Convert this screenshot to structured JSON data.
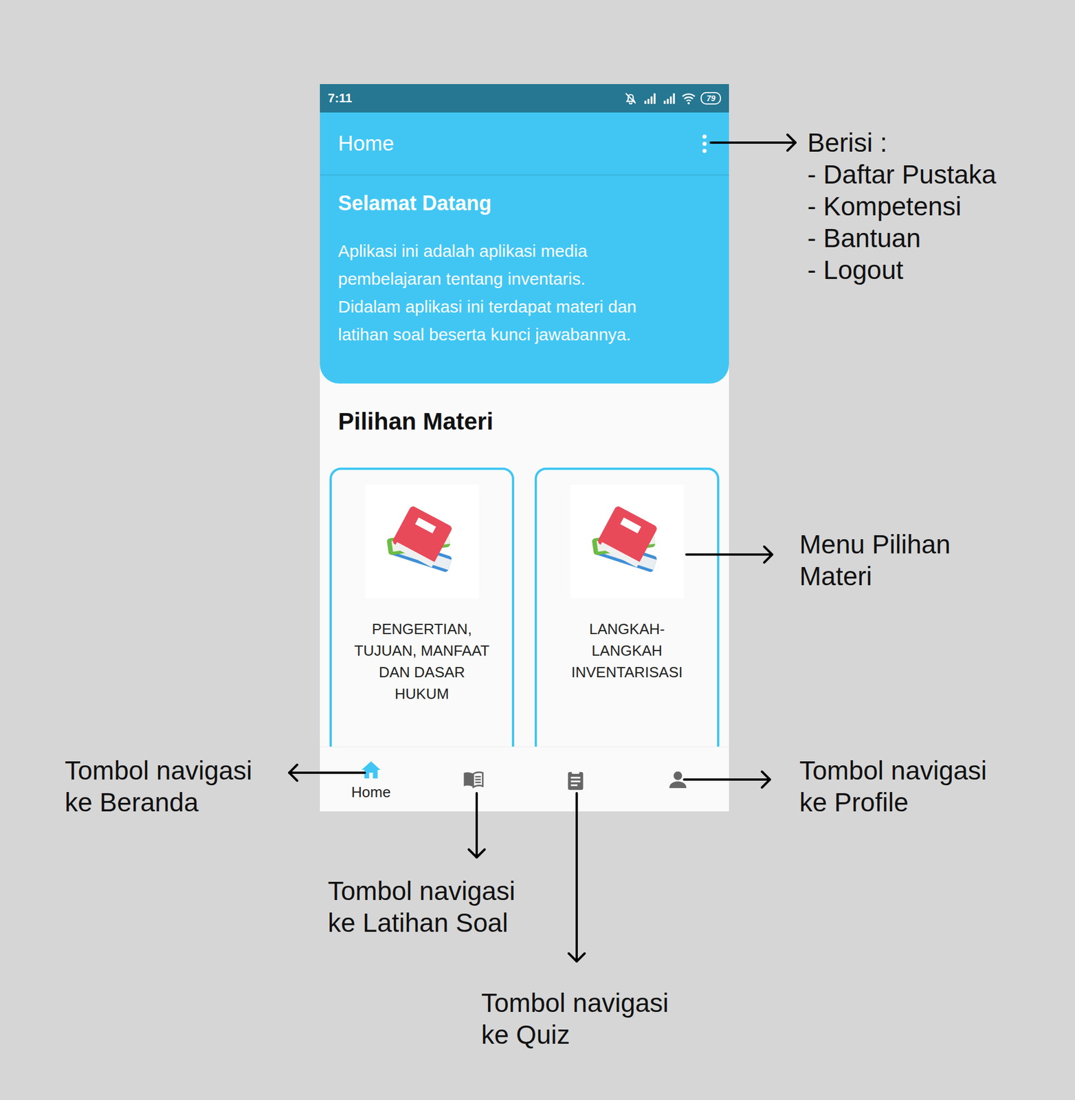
{
  "status_bar": {
    "time": "7:11",
    "battery": "79"
  },
  "app_bar": {
    "title": "Home"
  },
  "welcome": {
    "title": "Selamat Datang",
    "lines": [
      "Aplikasi ini adalah aplikasi media",
      "pembelajaran tentang inventaris.",
      "Didalam aplikasi ini terdapat materi dan",
      "latihan soal beserta kunci jawabannya."
    ]
  },
  "section_title": "Pilihan Materi",
  "materi": [
    {
      "lines": [
        "PENGERTIAN,",
        "TUJUAN, MANFAAT",
        "DAN DASAR",
        "HUKUM"
      ]
    },
    {
      "lines": [
        "LANGKAH-",
        "LANGKAH",
        "INVENTARISASI"
      ]
    }
  ],
  "bottom_nav": [
    {
      "label": "Home",
      "selected": true
    },
    {
      "label": "",
      "selected": false
    },
    {
      "label": "",
      "selected": false
    },
    {
      "label": "",
      "selected": false
    }
  ],
  "annotations": [
    {
      "lines": [
        "Berisi :",
        "- Daftar Pustaka",
        "- Kompetensi",
        "- Bantuan",
        "- Logout"
      ]
    },
    {
      "lines": [
        "Menu Pilihan",
        "Materi"
      ]
    },
    {
      "lines": [
        "Tombol navigasi",
        "ke Beranda"
      ]
    },
    {
      "lines": [
        "Tombol navigasi",
        "ke Profile"
      ]
    },
    {
      "lines": [
        "Tombol navigasi",
        "ke Latihan Soal"
      ]
    },
    {
      "lines": [
        "Tombol navigasi",
        "ke Quiz"
      ]
    }
  ]
}
